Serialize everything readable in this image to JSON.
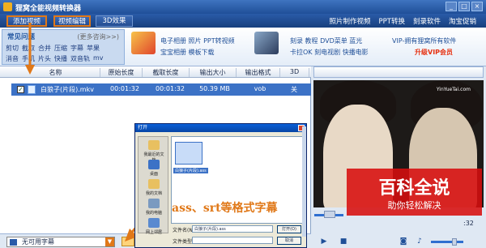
{
  "window": {
    "title": "狸窝全能视频转换器",
    "controls": [
      "_",
      "□",
      "×"
    ]
  },
  "toolbar": {
    "add_video": "添加视频",
    "edit_video": "视频编辑",
    "effect_3d": "3D效果",
    "links": [
      "照片制作视频",
      "PPT转换",
      "刻录软件",
      "淘宝促销"
    ]
  },
  "faq": {
    "title": "常见问题",
    "more": "(更多咨询>>)",
    "row1": [
      "剪切",
      "截取",
      "合并",
      "压缩",
      "字幕",
      "苹果"
    ],
    "row2": [
      "消音",
      "手机",
      "片头",
      "快播",
      "双音轨",
      "mv"
    ]
  },
  "promos": {
    "group1_line1": "电子相册  照片  PPT转视频",
    "group1_line2": "宝宝相册  模板下载",
    "group2_line1": "刻录  教程  DVD菜单  蓝光",
    "group2_line2": "卡拉OK  刻电视剧  快播电影",
    "vip_line1": "VIP-拥有狸窝所有软件",
    "vip_line2": "升级VIP会员"
  },
  "list": {
    "headers": [
      "名称",
      "原始长度",
      "截取长度",
      "输出大小",
      "输出格式",
      "3D"
    ],
    "rows": [
      {
        "name": "白狼子(片段).mkv",
        "original": "00:01:32",
        "clip": "00:01:32",
        "size": "50.39 MB",
        "format": "vob",
        "d3": "关"
      }
    ]
  },
  "subtitle": {
    "selected": "无可用字幕"
  },
  "dialog": {
    "title": "打开",
    "side": [
      "我最近的文档",
      "桌面",
      "我的文档",
      "我的电脑",
      "网上邻居"
    ],
    "file_label": "白狼子(片段).ass",
    "filename_label": "文件名(N):",
    "filename_value": "白狼子(片段).ass",
    "filetype_label": "文件类型(T):",
    "open_button": "打开(O)",
    "cancel_button": "取消"
  },
  "caption": "ass、srt等格式字幕",
  "preview": {
    "watermark": "YinYueTai.com",
    "time": ":32",
    "overlay_title": "百科全说",
    "overlay_sub": "助你轻松解决"
  },
  "colors": {
    "accent": "#e07818",
    "row_selected": "#3c72c6",
    "toolbar": "#1f4f98",
    "overlay": "#d70e0e"
  }
}
